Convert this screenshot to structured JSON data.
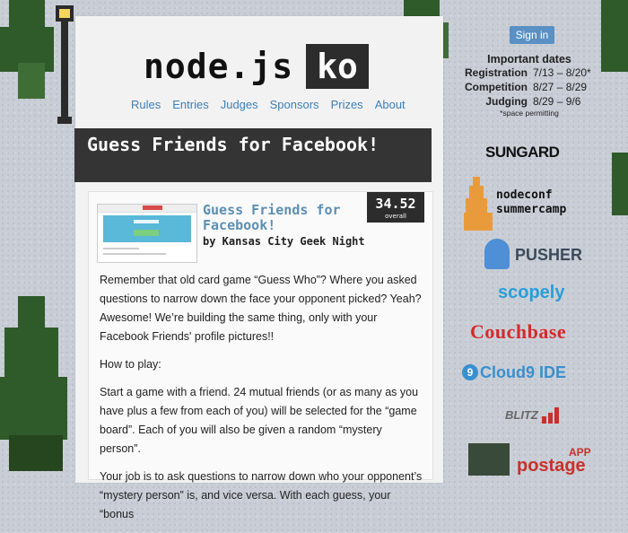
{
  "header": {
    "logo_text": "node.js",
    "logo_badge": "ko",
    "nav": [
      "Rules",
      "Entries",
      "Judges",
      "Sponsors",
      "Prizes",
      "About"
    ]
  },
  "page_title": "Guess Friends for Facebook!",
  "entry": {
    "title": "Guess Friends for Facebook!",
    "author": "by Kansas City Geek Night",
    "score": "34.52",
    "score_label": "overall",
    "thumbnail_title": "Guess Friends",
    "description": [
      "Remember that old card game “Guess Who”? Where you asked questions to narrow down the face your opponent picked? Yeah? Awesome! We’re building the same thing, only with your Facebook Friends' profile pictures!!",
      "How to play:",
      "Start a game with a friend. 24 mutual friends (or as many as you have plus a few from each of you) will be selected for the “game board”. Each of you will also be given a random “mystery person”.",
      "Your job is to ask questions to narrow down who your opponent’s “mystery person” is, and vice versa. With each guess, your “bonus"
    ]
  },
  "sidebar": {
    "signin_label": "Sign in",
    "dates_title": "Important dates",
    "dates": [
      {
        "label": "Registration",
        "value": "7/13 – 8/20*"
      },
      {
        "label": "Competition",
        "value": "8/27 – 8/29"
      },
      {
        "label": "Judging",
        "value": "8/29 – 9/6"
      }
    ],
    "dates_note": "*space permitting",
    "sponsors": {
      "sungard": "SUNGARD",
      "nodeconf_line1": "nodeconf",
      "nodeconf_line2": "summercamp",
      "pusher": "PUSHER",
      "scopely": "scopely",
      "couchbase": "Couchbase",
      "cloud9_mark": "9",
      "cloud9": "Cloud9 IDE",
      "blitz": "BLITZ",
      "postage_app": "APP",
      "postage": "postage"
    }
  },
  "colors": {
    "accent": "#3f7fb5",
    "title_bar": "#343434",
    "entry_title": "#5c8fb3",
    "signin": "#5a90c3"
  }
}
